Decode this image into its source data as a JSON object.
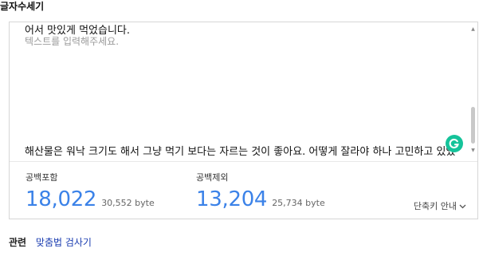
{
  "page": {
    "title": "글자수세기"
  },
  "editor": {
    "text_top": "어서 맛있게 먹었습니다.",
    "placeholder": "텍스트를 입력해주세요.",
    "text_bottom": "해산물은 워낙 크기도 해서 그냥 먹기 보다는 자르는 것이 좋아요. 어떻게 잘라야 하나 고민하고 있었"
  },
  "stats": {
    "with_spaces": {
      "label": "공백포함",
      "count": "18,022",
      "bytes": "30,552 byte"
    },
    "without_spaces": {
      "label": "공백제외",
      "count": "13,204",
      "bytes": "25,734 byte"
    }
  },
  "shortcut": {
    "label": "단축키 안내"
  },
  "related": {
    "label": "관련",
    "link": "맞춤법 검사기"
  },
  "colors": {
    "count": "#3b82e8",
    "badge": "#15c39a",
    "link": "#1a3cb0"
  },
  "icons": [
    "grammarly-g-icon",
    "chevron-down-icon",
    "scroll-up-icon",
    "scroll-down-icon"
  ]
}
